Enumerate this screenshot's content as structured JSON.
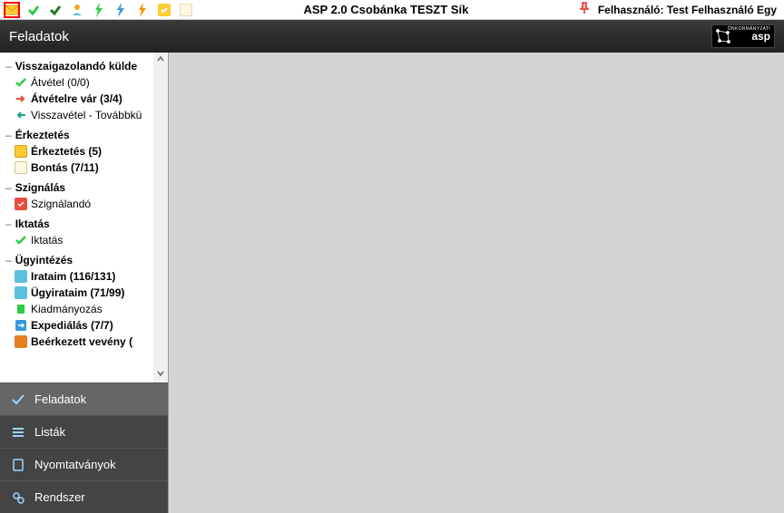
{
  "toolbar": {
    "title": "ASP 2.0 Csobánka TESZT Sík",
    "user_label": "Felhasználó:",
    "user_name": "Test Felhasználó Egy"
  },
  "header": {
    "title": "Feladatok",
    "logo_text": "asp",
    "logo_sub": "ÖNKORMÁNYZATI"
  },
  "tree": {
    "sections": [
      {
        "header": "Visszaigazolandó külde",
        "items": [
          {
            "label": "Átvétel (0/0)",
            "bold": false,
            "icon": "check-green"
          },
          {
            "label": "Átvételre vár (3/4)",
            "bold": true,
            "icon": "arrow-red"
          },
          {
            "label": "Visszavétel - Továbbkü",
            "bold": false,
            "icon": "arrow-teal"
          }
        ]
      },
      {
        "header": "Érkeztetés",
        "items": [
          {
            "label": "Érkeztetés (5)",
            "bold": true,
            "icon": "box-yellow"
          },
          {
            "label": "Bontás (7/11)",
            "bold": true,
            "icon": "box-cream"
          }
        ]
      },
      {
        "header": "Szignálás",
        "items": [
          {
            "label": "Szignálandó",
            "bold": false,
            "icon": "box-red"
          }
        ]
      },
      {
        "header": "Iktatás",
        "items": [
          {
            "label": "Iktatás",
            "bold": false,
            "icon": "check-green"
          }
        ]
      },
      {
        "header": "Ügyintézés",
        "items": [
          {
            "label": "Irataim (116/131)",
            "bold": true,
            "icon": "box-blue"
          },
          {
            "label": "Ügyirataim (71/99)",
            "bold": true,
            "icon": "box-blue"
          },
          {
            "label": "Kiadmányozás",
            "bold": false,
            "icon": "doc-green"
          },
          {
            "label": "Expediálás (7/7)",
            "bold": true,
            "icon": "arrow-blue"
          },
          {
            "label": "Beérkezett vevény (",
            "bold": true,
            "icon": "box-red2"
          }
        ]
      }
    ]
  },
  "nav": {
    "items": [
      {
        "label": "Feladatok",
        "icon": "check"
      },
      {
        "label": "Listák",
        "icon": "list"
      },
      {
        "label": "Nyomtatványok",
        "icon": "doc"
      },
      {
        "label": "Rendszer",
        "icon": "gear"
      }
    ]
  }
}
